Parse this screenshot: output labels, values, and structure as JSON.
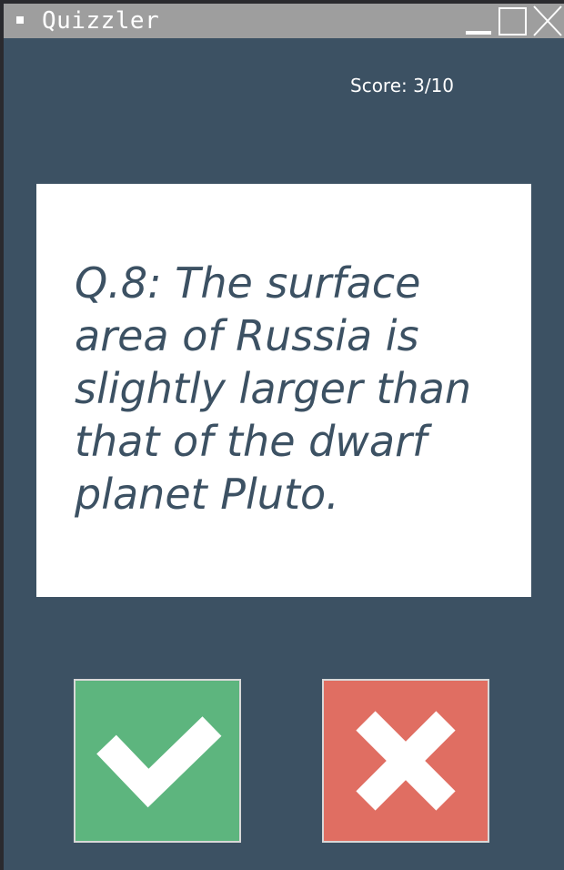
{
  "window": {
    "title": "Quizzler"
  },
  "score": {
    "label": "Score: 3/10"
  },
  "question": {
    "text": "Q.8: The surface area of Russia is slightly larger than that of the dwarf planet Pluto."
  },
  "buttons": {
    "true_icon": "check-icon",
    "false_icon": "cross-icon"
  },
  "colors": {
    "background": "#3c5163",
    "card": "#ffffff",
    "true_button": "#5db57e",
    "false_button": "#e06e62",
    "titlebar": "#9e9e9e"
  }
}
